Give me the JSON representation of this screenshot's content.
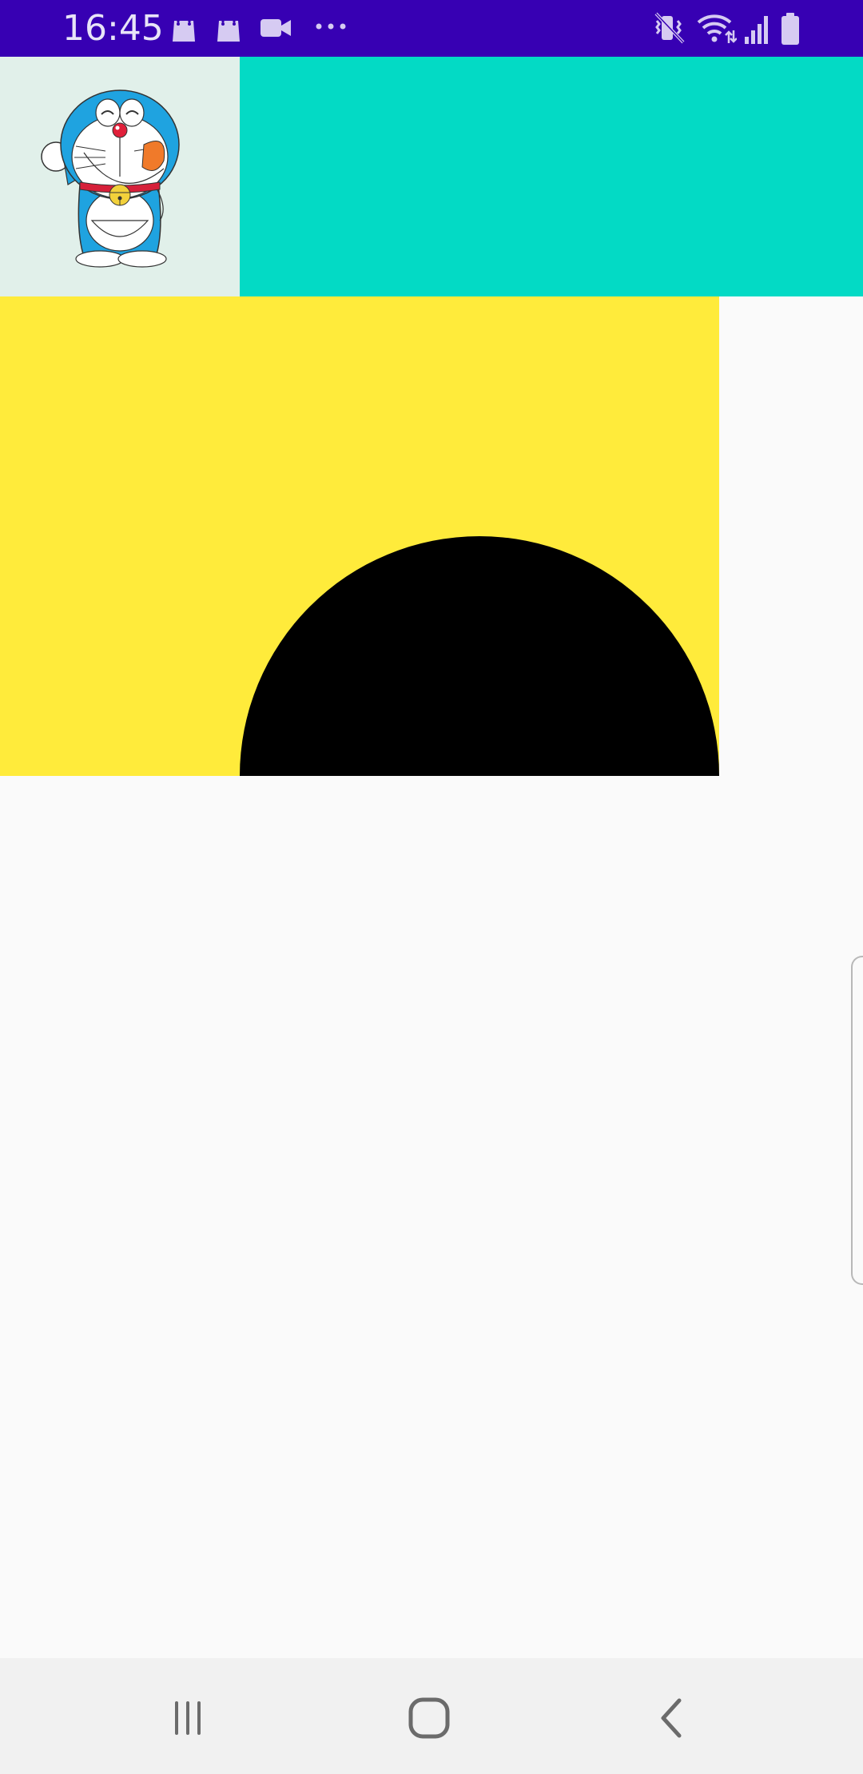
{
  "status_bar": {
    "time": "16:45",
    "background": "#3700b3",
    "left_icons": [
      "shopping-bag-icon",
      "shopping-bag-icon",
      "video-camera-icon",
      "more-dots-icon"
    ],
    "right_icons": [
      "mute-vibrate-icon",
      "wifi-icon",
      "signal-icon",
      "battery-icon"
    ]
  },
  "content": {
    "avatar_panel_color": "#e1f0ea",
    "teal_panel_color": "#03dac5",
    "yellow_panel_color": "#ffeb3b",
    "half_circle_color": "#000000",
    "avatar_icon": "doraemon-image"
  },
  "nav_bar": {
    "buttons": [
      "recent-apps-icon",
      "home-icon",
      "back-icon"
    ]
  }
}
